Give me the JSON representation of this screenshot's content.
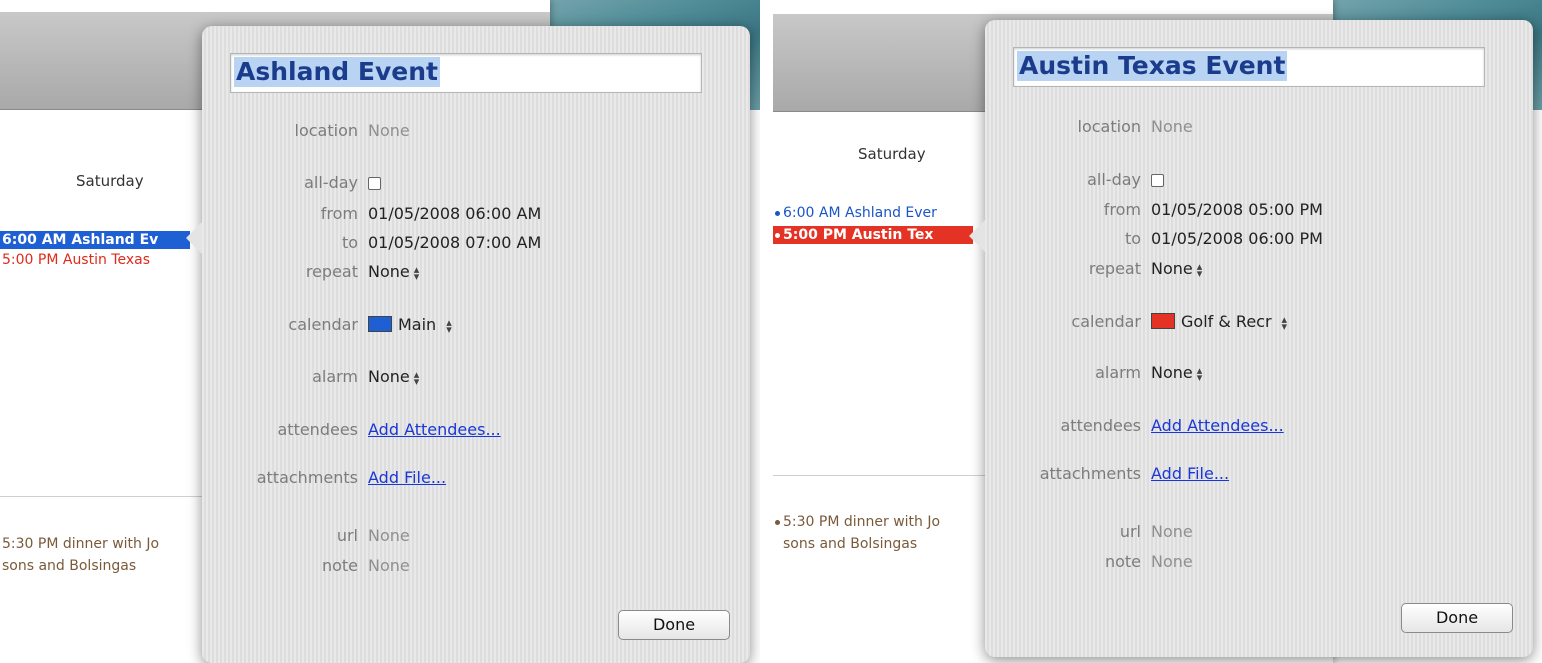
{
  "left": {
    "calendar": {
      "day_header": "Saturday",
      "event_selected": "6:00 AM Ashland Ev",
      "event_second": "5:00 PM Austin Texas",
      "event_dinner_line1": "5:30 PM dinner with Jo",
      "event_dinner_line2": "sons and Bolsingas"
    },
    "popover": {
      "title": "Ashland Event",
      "labels": {
        "location": "location",
        "all_day": "all-day",
        "from": "from",
        "to": "to",
        "repeat": "repeat",
        "calendar": "calendar",
        "alarm": "alarm",
        "attendees": "attendees",
        "attachments": "attachments",
        "url": "url",
        "note": "note"
      },
      "location": "None",
      "from": "01/05/2008 06:00 AM",
      "to": "01/05/2008 07:00 AM",
      "repeat": "None",
      "calendar_name": "Main",
      "calendar_color": "#1e5fd3",
      "alarm": "None",
      "attendees": "Add Attendees...",
      "attachments": "Add File...",
      "url": "None",
      "note": "None",
      "done": "Done"
    }
  },
  "right": {
    "calendar": {
      "day_header": "Saturday",
      "event_first": "6:00 AM Ashland Ever",
      "event_selected": "5:00 PM Austin Tex",
      "event_dinner_line1": "5:30 PM dinner with Jo",
      "event_dinner_line2": "sons and Bolsingas"
    },
    "popover": {
      "title": "Austin Texas Event",
      "labels": {
        "location": "location",
        "all_day": "all-day",
        "from": "from",
        "to": "to",
        "repeat": "repeat",
        "calendar": "calendar",
        "alarm": "alarm",
        "attendees": "attendees",
        "attachments": "attachments",
        "url": "url",
        "note": "note"
      },
      "location": "None",
      "from": "01/05/2008 05:00 PM",
      "to": "01/05/2008 06:00 PM",
      "repeat": "None",
      "calendar_name": "Golf & Recr",
      "calendar_color": "#e43324",
      "alarm": "None",
      "attendees": "Add Attendees...",
      "attachments": "Add File...",
      "url": "None",
      "note": "None",
      "done": "Done"
    }
  }
}
